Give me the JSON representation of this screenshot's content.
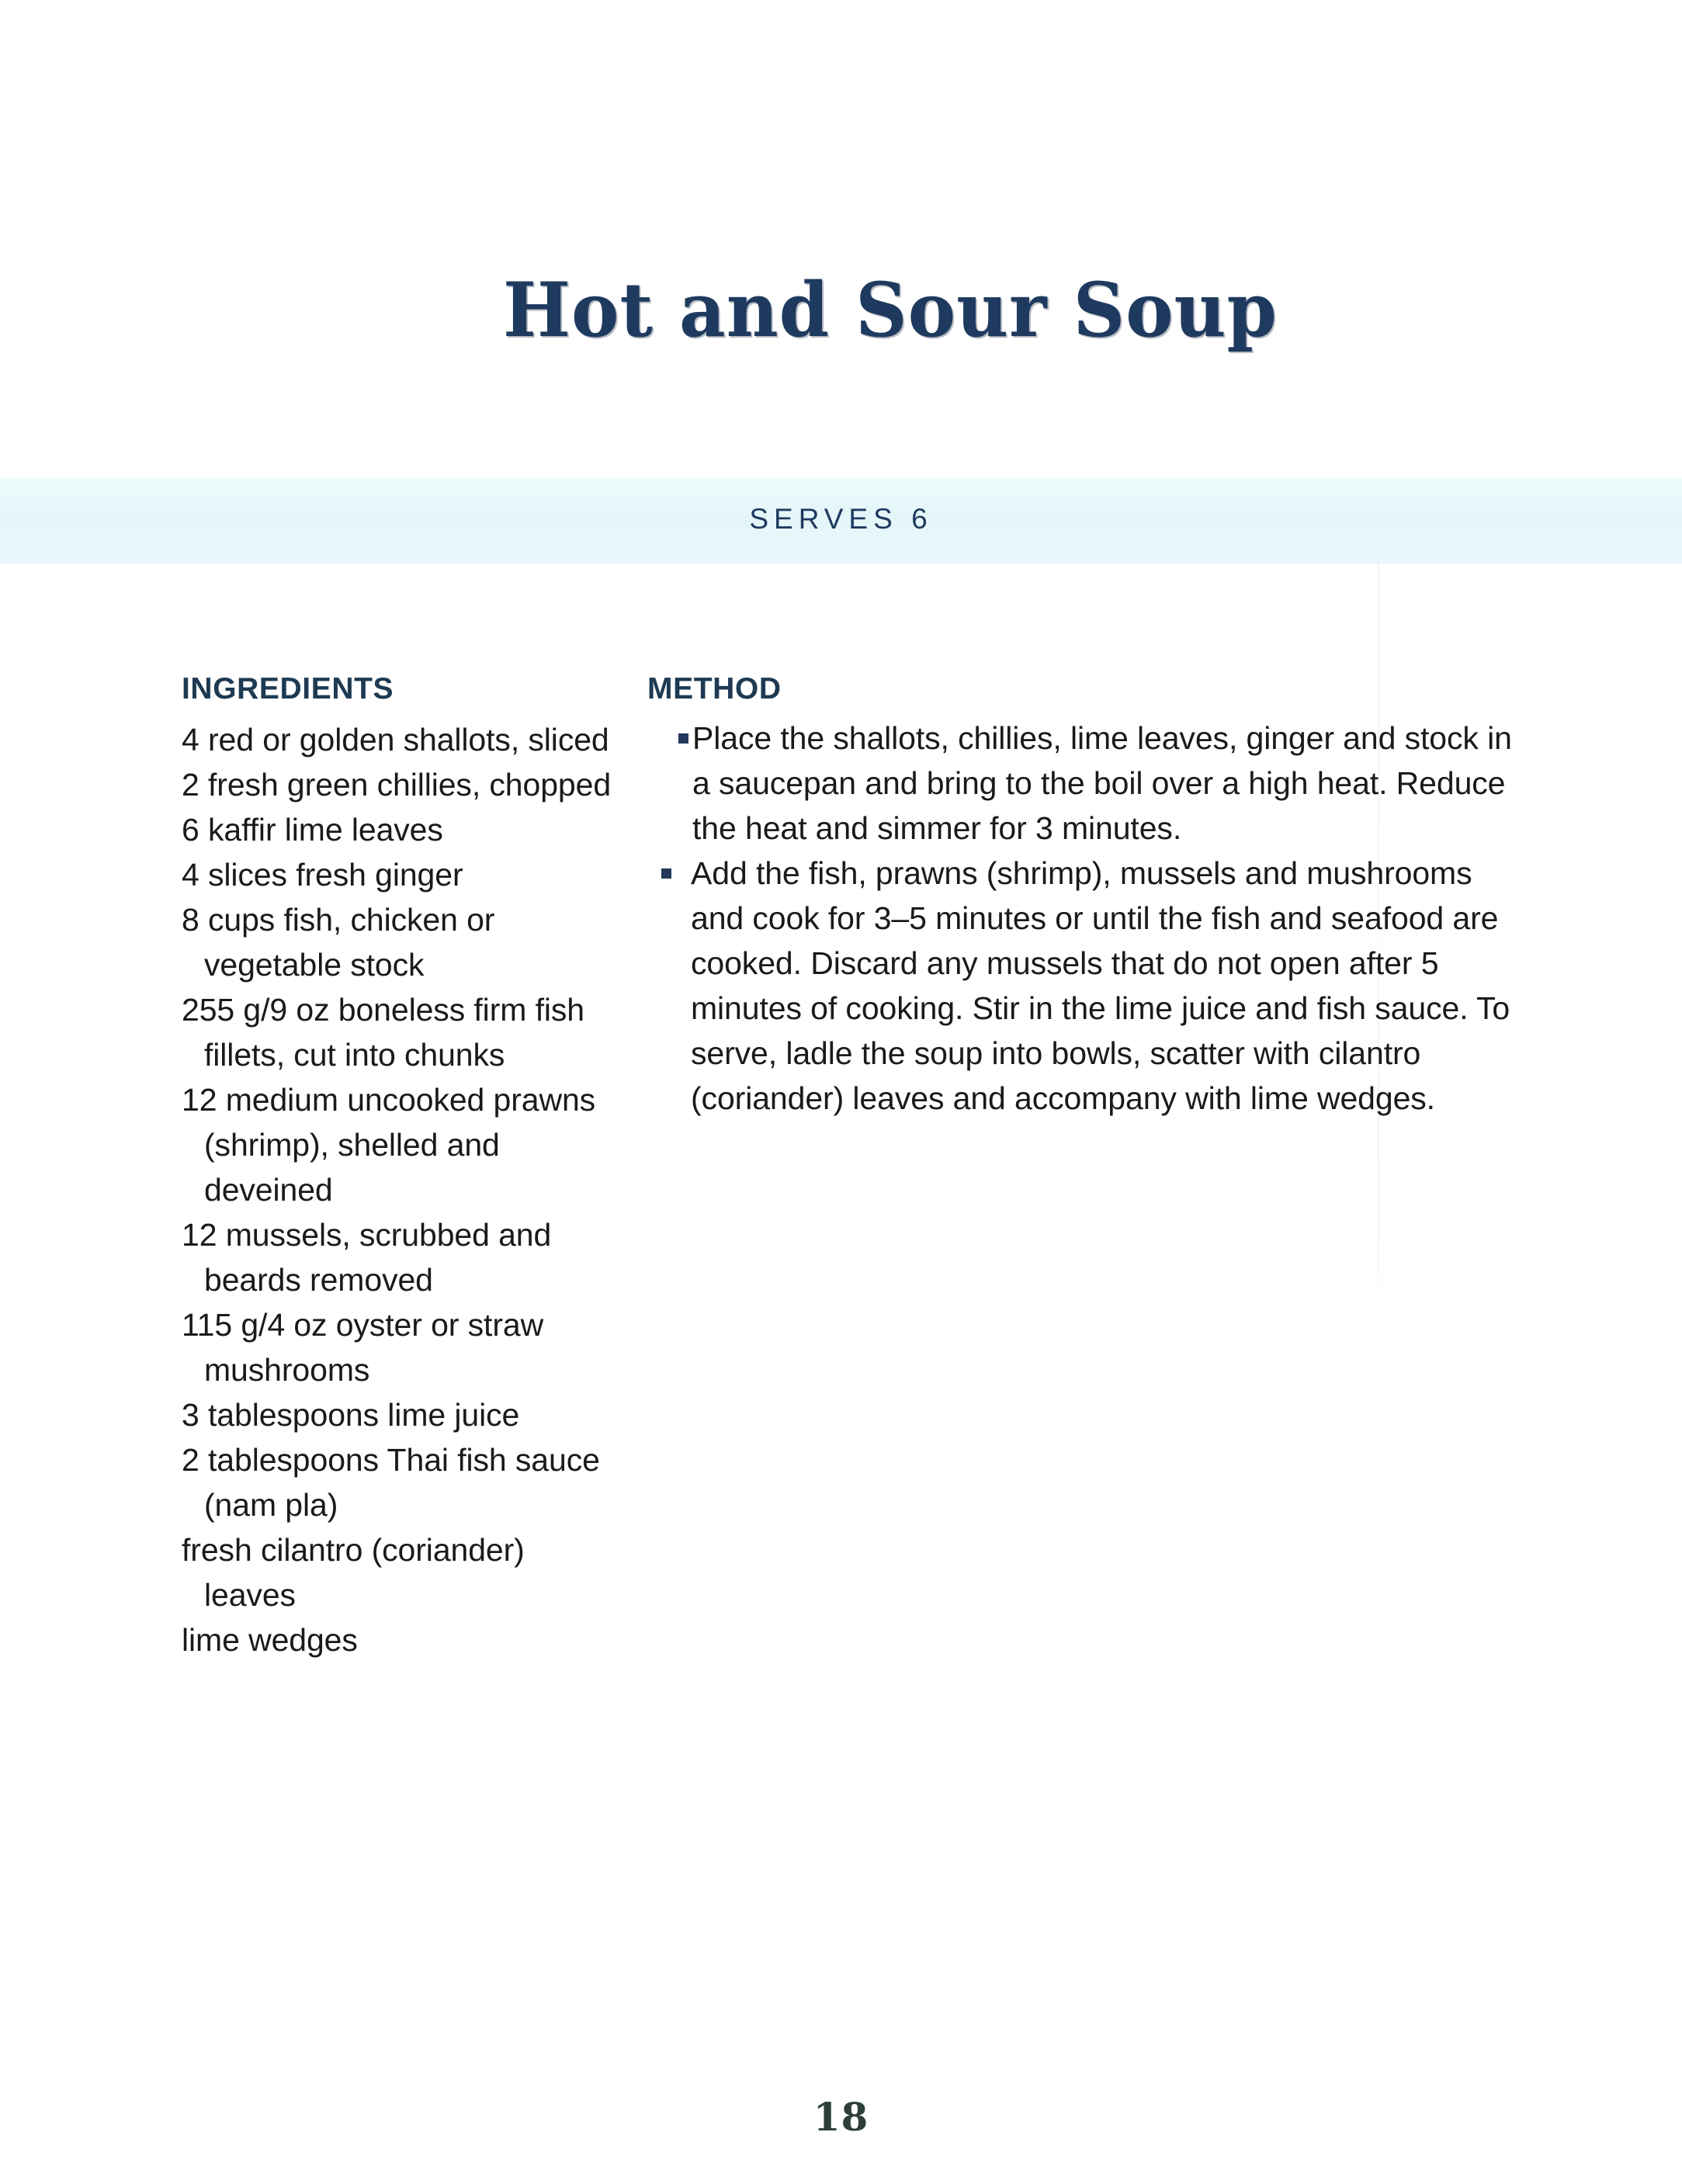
{
  "page": {
    "title": "Hot and Sour Soup",
    "serves_label": "SERVES 6",
    "page_number": "18",
    "colors": {
      "heading_navy": "#1d3a52",
      "title_navy": "#1f3a5f",
      "band_background": "#e6f7fa",
      "body_text": "#1a1a1a",
      "bullet": "#21395a",
      "page_number": "#2e3f3a",
      "page_background": "#ffffff"
    }
  },
  "ingredients": {
    "heading": "INGREDIENTS",
    "items": [
      "4 red or golden shallots, sliced",
      "2 fresh green chillies, chopped",
      "6 kaffir lime leaves",
      "4 slices fresh ginger",
      "8 cups fish, chicken or vegetable stock",
      "255 g/9 oz boneless firm fish fillets, cut into chunks",
      "12 medium uncooked prawns (shrimp), shelled and deveined",
      "12 mussels, scrubbed and beards removed",
      "115 g/4 oz oyster or straw mushrooms",
      "3 tablespoons lime juice",
      "2 tablespoons Thai fish sauce (nam pla)",
      "fresh cilantro (coriander) leaves",
      "lime wedges"
    ]
  },
  "method": {
    "heading": "METHOD",
    "steps": [
      "Place the shallots, chillies, lime leaves, ginger and stock in a saucepan and bring to the boil over a high heat. Reduce the heat and simmer for 3 minutes.",
      "Add the fish, prawns (shrimp), mussels and mushrooms and cook for 3–5 minutes or until the fish and seafood are cooked. Discard any mussels that do not open after 5 minutes of cooking. Stir in the lime juice and fish sauce. To serve, ladle the soup into bowls, scatter with cilantro (coriander) leaves and accompany with lime wedges."
    ]
  }
}
